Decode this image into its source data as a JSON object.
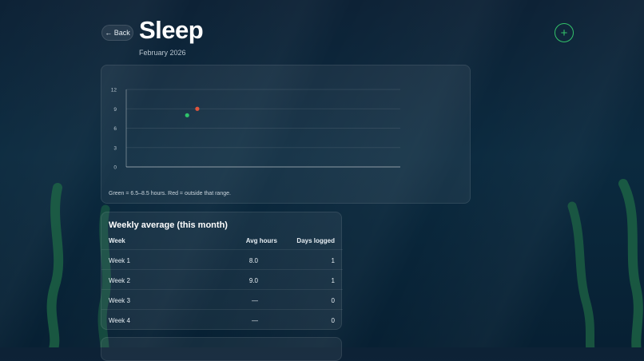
{
  "header": {
    "back_label": "← Back",
    "title": "Sleep",
    "subtitle": "February 2026",
    "add_label": "+"
  },
  "colors": {
    "accent": "#33c26a",
    "in_range": "#2ec26a",
    "out_of_range": "#e0553d",
    "background": "#0b2a3f"
  },
  "chart_data": {
    "type": "scatter",
    "title": "",
    "xlabel": "",
    "ylabel": "",
    "ylim": [
      0,
      12
    ],
    "yticks": [
      0,
      3,
      6,
      9,
      12
    ],
    "grid": true,
    "x_range": [
      1,
      28
    ],
    "points": [
      {
        "x": 7,
        "y": 8.0,
        "status": "in_range"
      },
      {
        "x": 8,
        "y": 9.0,
        "status": "out_of_range"
      }
    ]
  },
  "chart_note": "Green = 6.5–8.5 hours. Red = outside that range.",
  "weekly": {
    "title": "Weekly average (this month)",
    "columns": [
      "Week",
      "Avg hours",
      "Days logged"
    ],
    "rows": [
      {
        "week": "Week 1",
        "avg": "8.0",
        "days": "1"
      },
      {
        "week": "Week 2",
        "avg": "9.0",
        "days": "1"
      },
      {
        "week": "Week 3",
        "avg": "—",
        "days": "0"
      },
      {
        "week": "Week 4",
        "avg": "—",
        "days": "0"
      }
    ]
  }
}
